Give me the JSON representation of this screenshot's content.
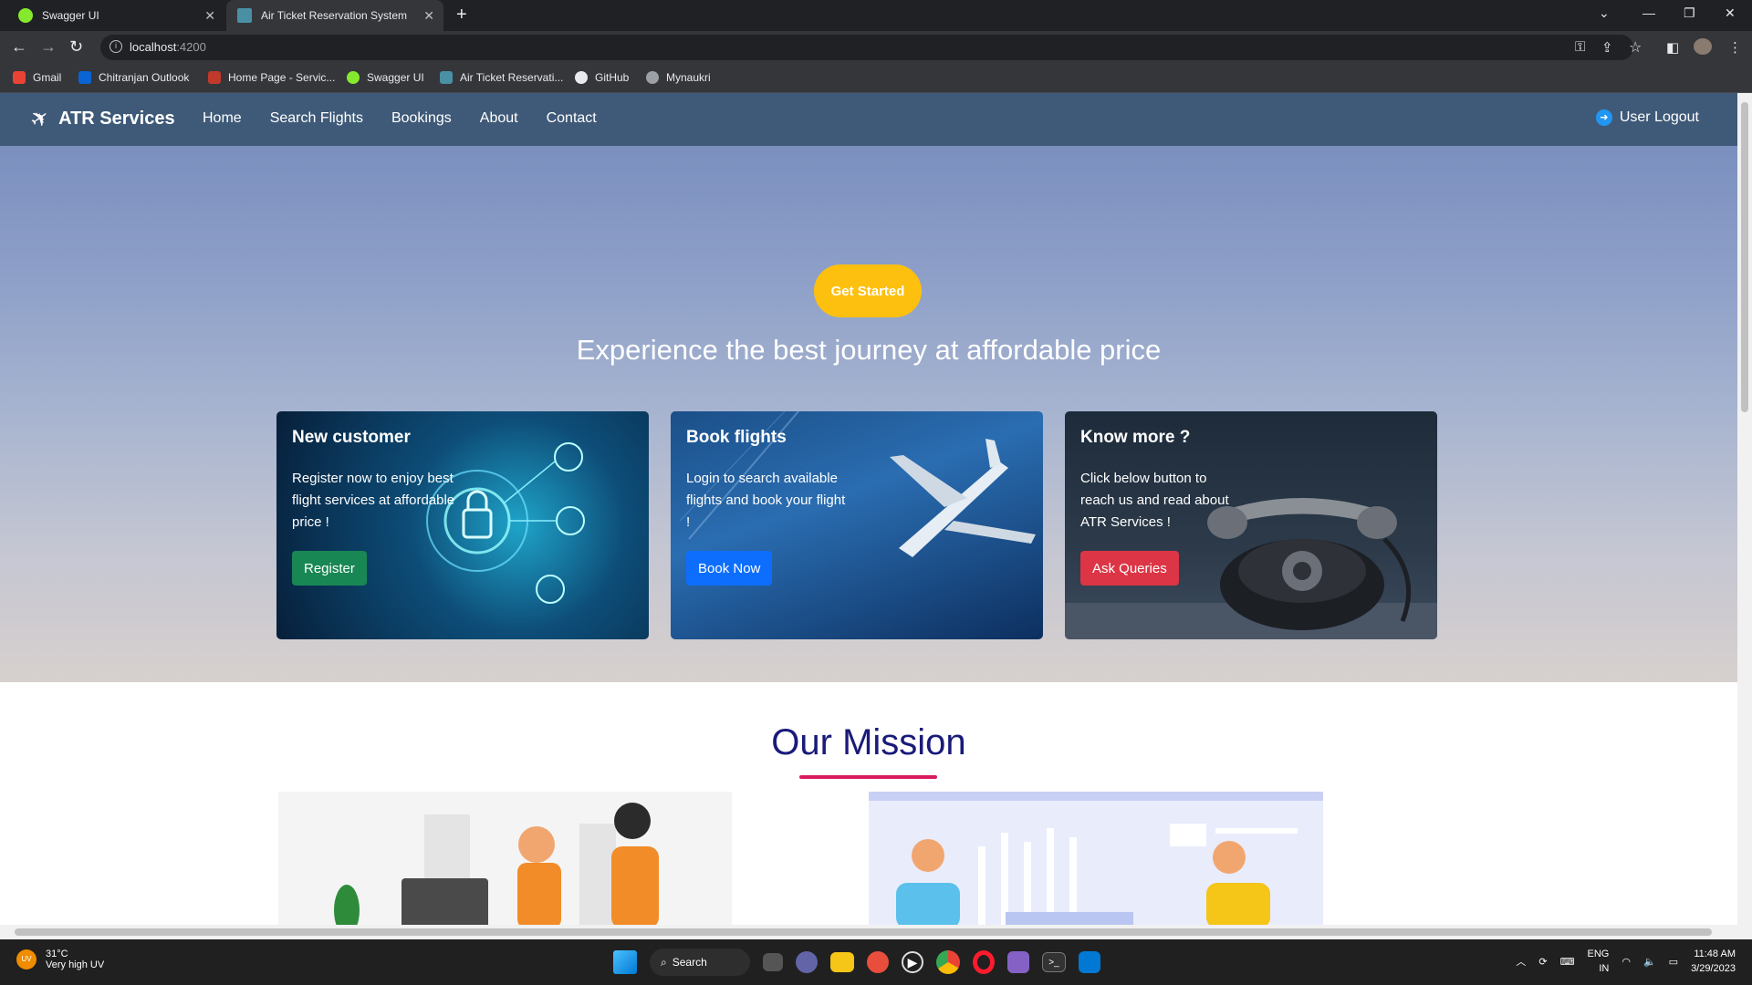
{
  "browser": {
    "tabs": [
      {
        "label": "Swagger UI",
        "active": false
      },
      {
        "label": "Air Ticket Reservation System",
        "active": true
      }
    ],
    "url_host": "localhost",
    "url_port": ":4200",
    "bookmarks": [
      "Gmail",
      "Chitranjan Outlook",
      "Home Page - Servic...",
      "Swagger UI",
      "Air Ticket Reservati...",
      "GitHub",
      "Mynaukri"
    ]
  },
  "app": {
    "brand": "ATR Services",
    "nav": [
      "Home",
      "Search Flights",
      "Bookings",
      "About",
      "Contact"
    ],
    "logout": "User Logout",
    "hero": {
      "cta": "Get Started",
      "title": "Experience the best journey at affordable price"
    },
    "cards": [
      {
        "title": "New customer",
        "text": "Register now to enjoy best flight services at affordable price !",
        "button": "Register"
      },
      {
        "title": "Book flights",
        "text": "Login to search available flights and book your flight !",
        "button": "Book Now"
      },
      {
        "title": "Know more ?",
        "text": "Click below button to reach us and read about ATR Services !",
        "button": "Ask Queries"
      }
    ],
    "mission_title": "Our Mission"
  },
  "taskbar": {
    "weather_temp": "31°C",
    "weather_desc": "Very high UV",
    "weather_badge": "UV",
    "search": "Search",
    "lang1": "ENG",
    "lang2": "IN",
    "time": "11:48 AM",
    "date": "3/29/2023"
  },
  "colors": {
    "navbar": "#3f5a78",
    "cta": "#fdc00f",
    "register": "#198754",
    "booknow": "#0d6efd",
    "ask": "#dc3545",
    "mission": "#1a1a7a",
    "mission_underline": "#d81b60"
  }
}
